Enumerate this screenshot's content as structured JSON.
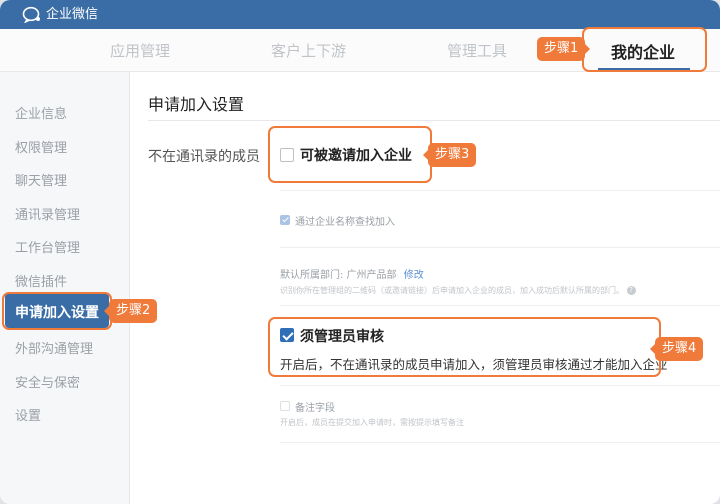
{
  "app": {
    "name": "企业微信",
    "logo_icon": "wecom-logo-icon"
  },
  "top_nav": {
    "tabs": [
      {
        "label": "应用管理",
        "active": false
      },
      {
        "label": "客户上下游",
        "active": false
      },
      {
        "label": "管理工具",
        "active": false
      },
      {
        "label": "我的企业",
        "active": true
      }
    ]
  },
  "sidebar": {
    "items": [
      {
        "label": "企业信息"
      },
      {
        "label": "权限管理"
      },
      {
        "label": "聊天管理"
      },
      {
        "label": "通讯录管理"
      },
      {
        "label": "工作台管理"
      },
      {
        "label": "微信插件"
      },
      {
        "label": "申请加入设置",
        "active": true
      },
      {
        "label": "外部沟通管理"
      },
      {
        "label": "安全与保密"
      },
      {
        "label": "设置"
      }
    ]
  },
  "page": {
    "title": "申请加入设置",
    "row_label": "不在通讯录的成员",
    "invite_option": {
      "label": "可被邀请加入企业",
      "checked": false
    },
    "search_option": {
      "label": "通过企业名称查找加入",
      "checked": true
    },
    "department": {
      "label": "默认所属部门: 广州产品部",
      "edit_link": "修改",
      "hint": "识别你所在管理组的二维码（或邀请链接）后申请加入企业的成员，加入成功后默认所属的部门。"
    },
    "admin_review": {
      "label": "须管理员审核",
      "checked": true,
      "description": "开启后，不在通讯录的成员申请加入，须管理员审核通过才能加入企业"
    },
    "note_field": {
      "label": "备注字段",
      "checked": false,
      "hint": "开启后，成员在提交加入申请时，需按提示填写备注"
    }
  },
  "callouts": {
    "step1": "步骤1",
    "step2": "步骤2",
    "step3": "步骤3",
    "step4": "步骤4"
  },
  "colors": {
    "brand": "#3a6da6",
    "callout": "#f07a3a",
    "checkbox": "#2f6fb8"
  }
}
